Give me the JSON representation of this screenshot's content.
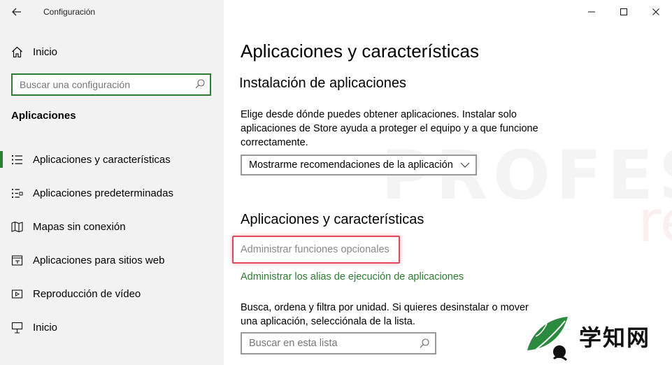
{
  "window": {
    "title": "Configuración",
    "controls": [
      "minimize-icon",
      "maximize-icon",
      "close-icon"
    ]
  },
  "sidebar": {
    "home_label": "Inicio",
    "search_placeholder": "Buscar una configuración",
    "section_title": "Aplicaciones",
    "items": [
      {
        "label": "Aplicaciones y características",
        "icon": "apps-list-icon",
        "active": true
      },
      {
        "label": "Aplicaciones predeterminadas",
        "icon": "default-apps-icon",
        "active": false
      },
      {
        "label": "Mapas sin conexión",
        "icon": "map-icon",
        "active": false
      },
      {
        "label": "Aplicaciones para sitios web",
        "icon": "website-app-icon",
        "active": false
      },
      {
        "label": "Reproducción de vídeo",
        "icon": "video-icon",
        "active": false
      },
      {
        "label": "Inicio",
        "icon": "startup-icon",
        "active": false
      }
    ]
  },
  "main": {
    "page_title": "Aplicaciones y características",
    "install_heading": "Instalación de aplicaciones",
    "install_description": "Elige desde dónde puedes obtener aplicaciones. Instalar solo aplicaciones de Store ayuda a proteger el equipo y a que funcione correctamente.",
    "install_dropdown_value": "Mostrarme recomendaciones de la aplicación",
    "apps_heading": "Aplicaciones y características",
    "optional_features_link": "Administrar funciones opcionales",
    "alias_link": "Administrar los alias de ejecución de aplicaciones",
    "apps_description": "Busca, ordena y filtra por unidad. Si quieres desinstalar o mover una aplicación, selecciónala de la lista.",
    "list_search_placeholder": "Buscar en esta lista"
  },
  "watermarks": {
    "brand_top": "PROFESIONAL",
    "brand_bottom": "review",
    "corner_logo_text": "学知网"
  },
  "colors": {
    "accent": "#2d7d32",
    "highlight": "#e6475a",
    "sidebar_bg": "#f2f2f2"
  }
}
